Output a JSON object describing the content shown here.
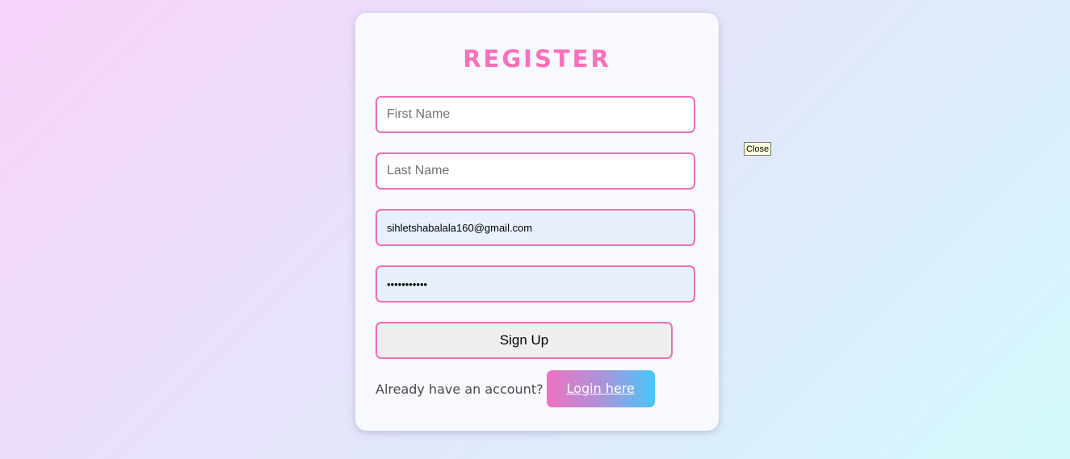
{
  "register": {
    "title": "REGISTER",
    "first_name": {
      "value": "",
      "placeholder": "First Name"
    },
    "last_name": {
      "value": "",
      "placeholder": "Last Name"
    },
    "email": {
      "value": "sihletshabalala160@gmail.com",
      "placeholder": ""
    },
    "password": {
      "value": "•••••••••••",
      "placeholder": ""
    },
    "signup_label": "Sign Up",
    "footer_text": "Already have an account?",
    "login_label": "Login here"
  },
  "tooltip": {
    "text": "Close"
  },
  "colors": {
    "accent": "#fc6fbc",
    "input_border": "#ee6fb6",
    "autofill_bg": "#e8f0fe",
    "login_gradient_start": "#ee72c0",
    "login_gradient_end": "#46c6fb"
  }
}
